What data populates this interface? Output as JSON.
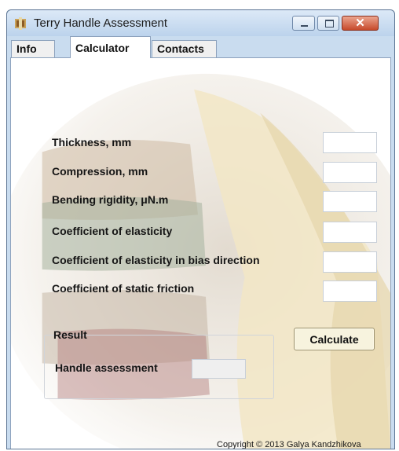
{
  "window": {
    "title": "Terry Handle Assessment",
    "controls": {
      "minimize_icon": "minimize-icon",
      "maximize_icon": "maximize-icon",
      "close_icon": "close-icon"
    }
  },
  "tabs": [
    {
      "label": "Info"
    },
    {
      "label": "Calculator",
      "selected": true
    },
    {
      "label": "Contacts"
    }
  ],
  "form": {
    "fields": [
      {
        "label": "Thickness, mm",
        "value": ""
      },
      {
        "label": "Compression, mm",
        "value": ""
      },
      {
        "label": "Bending rigidity, μN.m",
        "value": ""
      },
      {
        "label": "Coefficient of elasticity",
        "value": ""
      },
      {
        "label": "Coefficient of elasticity in bias direction",
        "value": ""
      },
      {
        "label": "Coefficient of static friction",
        "value": ""
      }
    ]
  },
  "result": {
    "group_label": "Result",
    "handle_label": "Handle assessment",
    "handle_value": ""
  },
  "actions": {
    "calculate_label": "Calculate"
  },
  "footer": {
    "copyright": "Copyright © 2013 Galya Kandzhikova"
  },
  "colors": {
    "titlebar": "#c9dcef",
    "close_button": "#c74a2b",
    "calculate_button": "#f7f3de"
  }
}
